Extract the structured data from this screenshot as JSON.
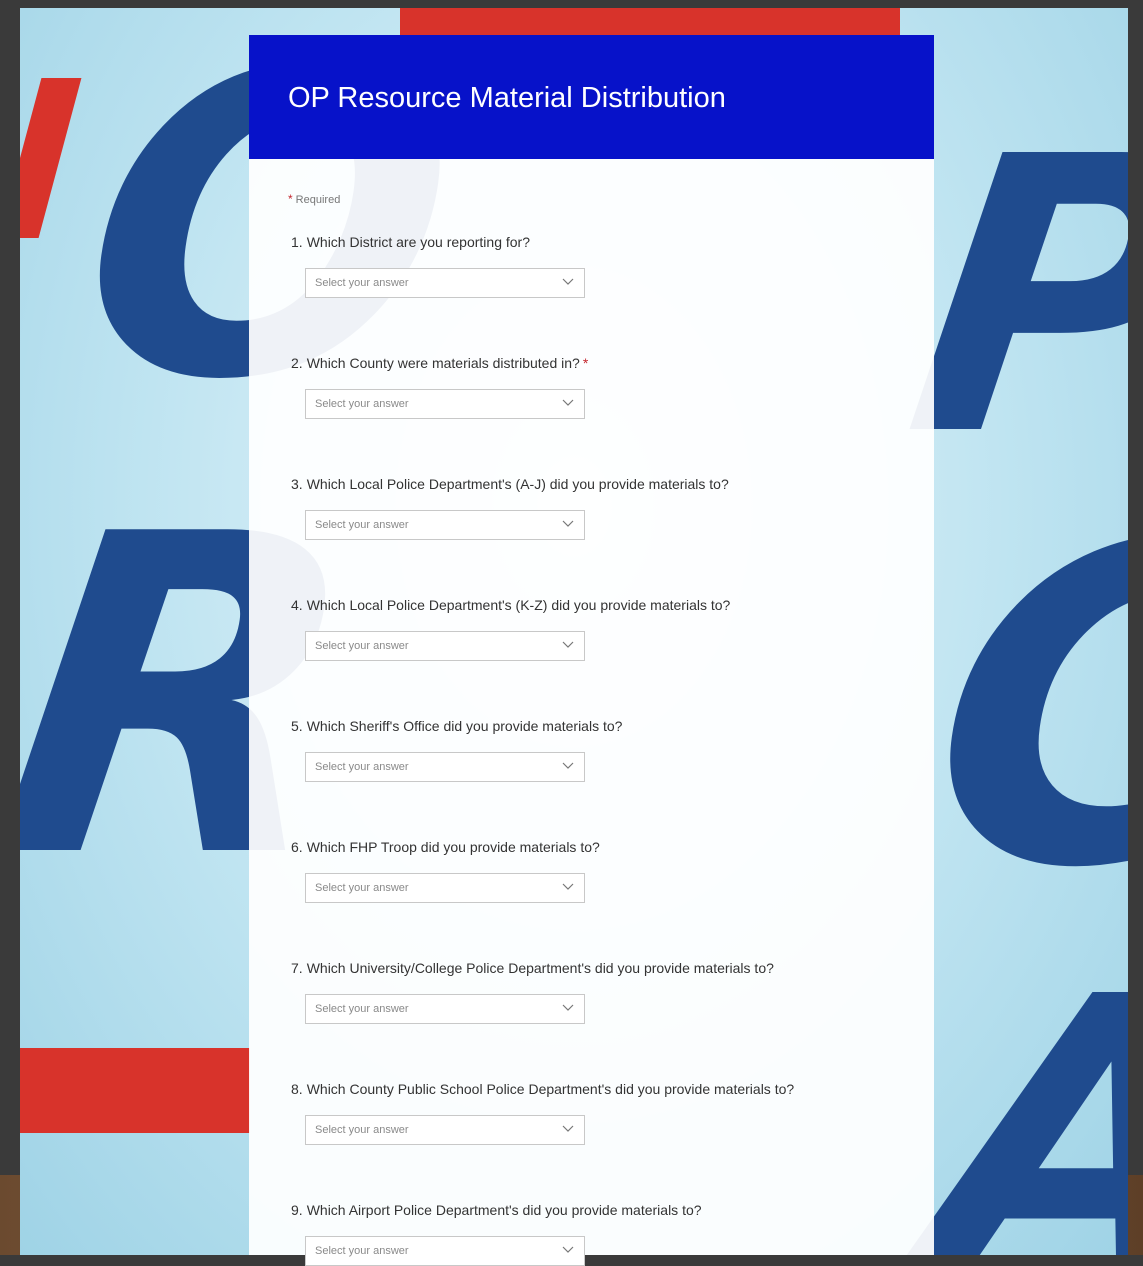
{
  "form": {
    "title": "OP Resource Material Distribution",
    "required_note": "Required",
    "required_star": "*",
    "placeholder": "Select your answer"
  },
  "questions": [
    {
      "num": "1.",
      "text": "Which District are you reporting for?",
      "required": false
    },
    {
      "num": "2.",
      "text": "Which County were materials distributed in?",
      "required": true
    },
    {
      "num": "3.",
      "text": "Which Local Police Department's (A-J) did you provide materials to?",
      "required": false
    },
    {
      "num": "4.",
      "text": "Which Local Police Department's (K-Z) did you provide materials to?",
      "required": false
    },
    {
      "num": "5.",
      "text": "Which Sheriff's Office did you provide materials to?",
      "required": false
    },
    {
      "num": "6.",
      "text": "Which FHP Troop did you provide materials to?",
      "required": false
    },
    {
      "num": "7.",
      "text": "Which University/College Police Department's did you provide materials to?",
      "required": false
    },
    {
      "num": "8.",
      "text": "Which County Public School Police Department's did you provide materials to?",
      "required": false
    },
    {
      "num": "9.",
      "text": "Which Airport Police Department's did you provide materials to?",
      "required": false
    }
  ],
  "colors": {
    "header": "#0712c9",
    "background_letters": "#1f4b8e",
    "accent_red": "#d8332b"
  },
  "icons": {
    "dropdown": "chevron-down-icon"
  }
}
